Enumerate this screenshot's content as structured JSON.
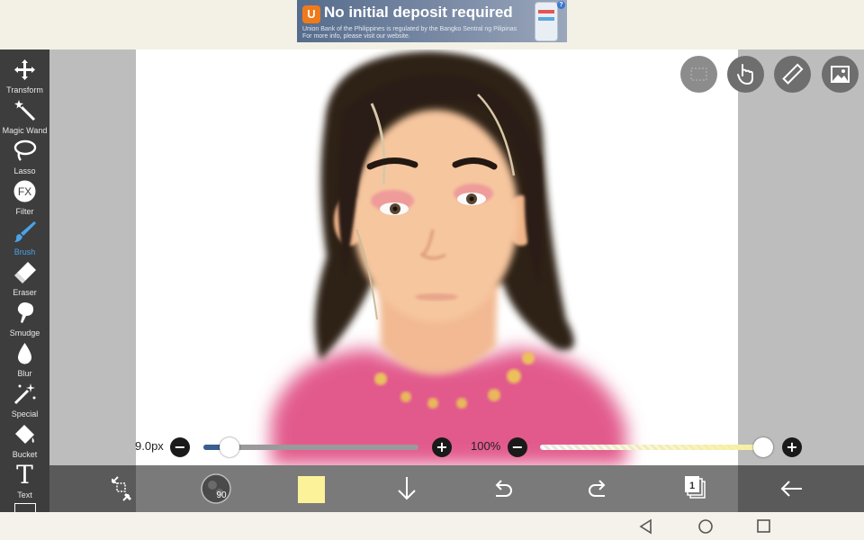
{
  "ad": {
    "logo_letter": "U",
    "headline": "No initial deposit required",
    "subline_1": "Union Bank of the Philippines is regulated by the Bangko Sentral ng Pilipinas",
    "subline_2": "For more info, please visit our website.",
    "info_mark": "?"
  },
  "tools": [
    {
      "label": "Transform",
      "icon": "move-arrows-icon"
    },
    {
      "label": "Magic Wand",
      "icon": "magic-wand-icon"
    },
    {
      "label": "Lasso",
      "icon": "lasso-icon"
    },
    {
      "label": "Filter",
      "icon": "fx-icon",
      "glyph": "FX"
    },
    {
      "label": "Brush",
      "icon": "brush-icon",
      "active": true
    },
    {
      "label": "Eraser",
      "icon": "eraser-icon"
    },
    {
      "label": "Smudge",
      "icon": "smudge-icon"
    },
    {
      "label": "Blur",
      "icon": "blur-drop-icon"
    },
    {
      "label": "Special",
      "icon": "sparkle-wand-icon"
    },
    {
      "label": "Bucket",
      "icon": "bucket-icon"
    },
    {
      "label": "Text",
      "icon": "text-icon",
      "glyph": "T"
    }
  ],
  "brush_size": {
    "label": "9.0px",
    "value_fraction": 0.12,
    "minus": "−",
    "plus": "+"
  },
  "opacity": {
    "label": "100%",
    "value_fraction": 1.0,
    "minus": "−",
    "plus": "+"
  },
  "brush_preview_value": "90",
  "colors": {
    "toolbar_bg": "#3d3d3d",
    "active_tool": "#4aa3e8",
    "current_color": "#fbf29a",
    "size_track_fill": "#3a5f8f",
    "opacity_track_fill": "#f7ef9e"
  },
  "bottom_actions": [
    "selection-transform-icon",
    "brush-preview",
    "color-swatch",
    "download-arrow-icon",
    "undo-icon",
    "redo-icon",
    "layers-icon",
    "back-arrow-icon"
  ],
  "layers_count": "1",
  "nav": [
    "back-triangle-icon",
    "home-circle-icon",
    "recents-square-icon"
  ]
}
